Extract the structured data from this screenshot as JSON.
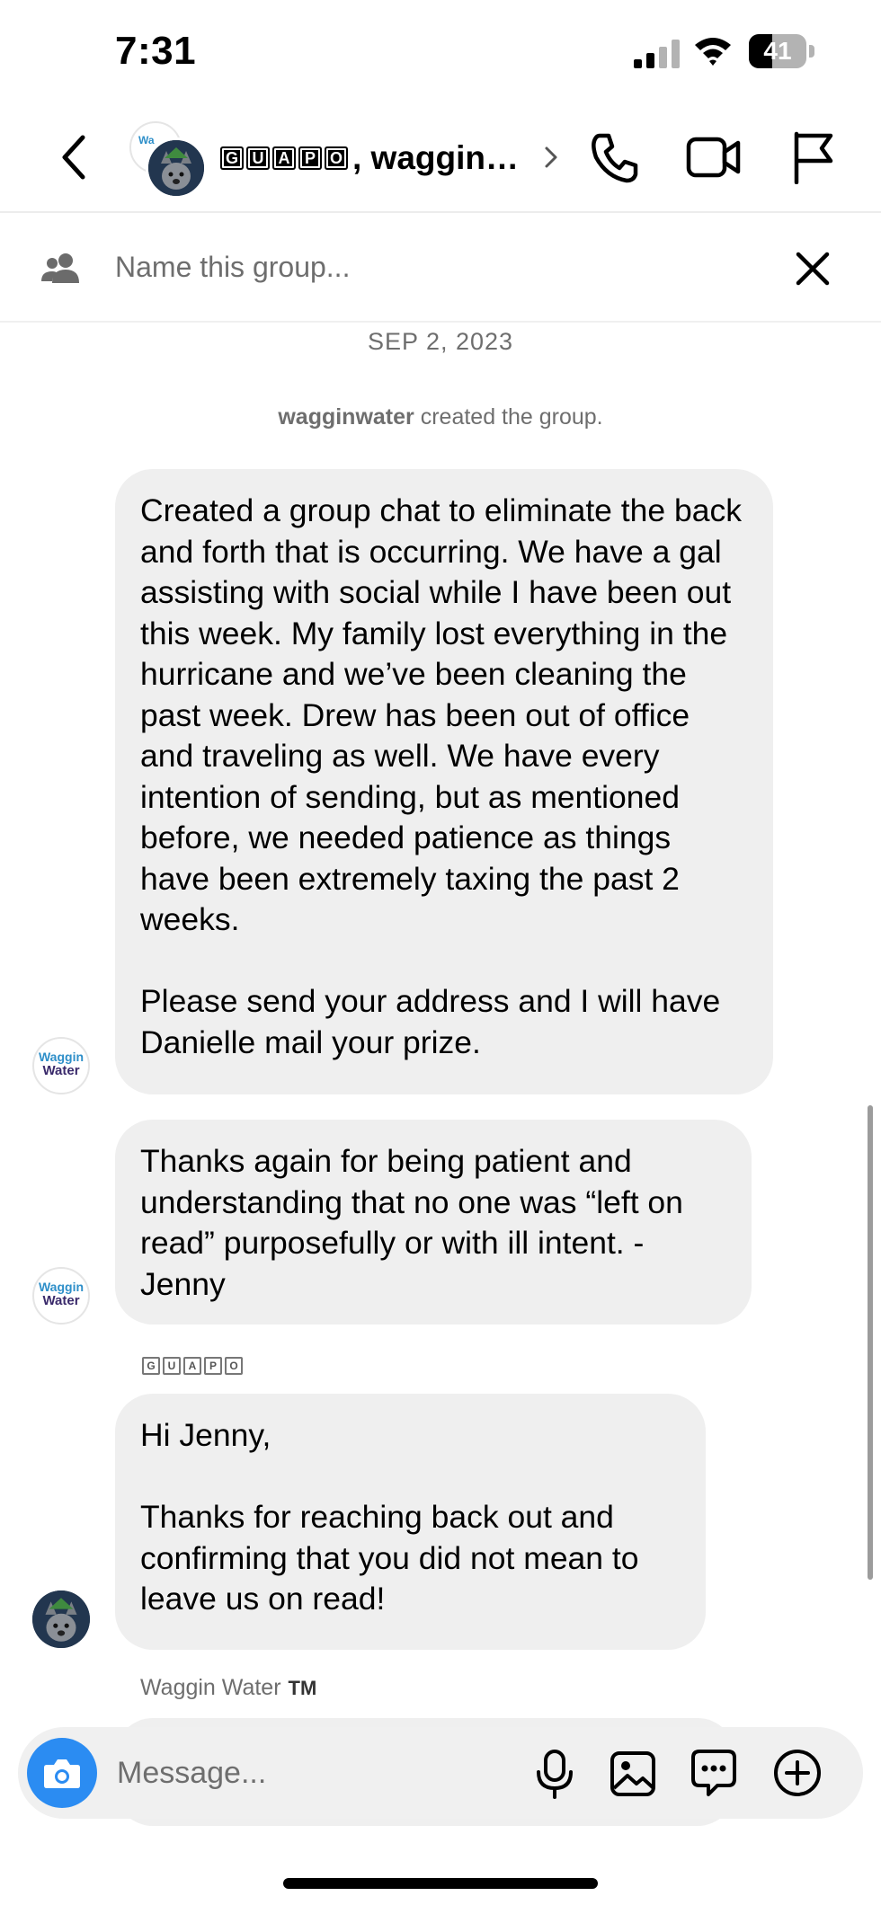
{
  "status_bar": {
    "time": "7:31",
    "battery": "41",
    "battery_level": 0.41
  },
  "header": {
    "group_name_boxed": [
      "G",
      "U",
      "A",
      "P",
      "O"
    ],
    "group_name_rest": ", waggin…",
    "avatar_back_text": "Wa"
  },
  "group_name_field": {
    "placeholder": "Name this group..."
  },
  "thread": {
    "date": "SEP 2, 2023",
    "system_user": "wagginwater",
    "system_text": " created the group.",
    "avatar_ww_line1": "Waggin",
    "avatar_ww_line2": "Water",
    "messages": [
      {
        "text": "Created a group chat to eliminate the back and forth that is occurring.  We have a gal assisting with social while I have been out this week. My family lost everything in the hurricane and we’ve been cleaning the past week.  Drew has been out of office and traveling as well.  We have every intention of sending, but as mentioned before, we needed patience as things have been extremely taxing the past 2 weeks.\n\nPlease send your address and I will have Danielle mail your prize."
      },
      {
        "text": "Thanks again for being patient and understanding that no one was “left on read” purposefully or with ill intent. -Jenny"
      },
      {
        "sender_boxed": [
          "G",
          "U",
          "A",
          "P",
          "O"
        ],
        "text": "Hi Jenny,\n\nThanks for reaching back out and confirming that you did not mean to leave us on read!"
      },
      {
        "sender": "Waggin Water",
        "sender_mark": "TM",
        "text": ""
      }
    ]
  },
  "composer": {
    "placeholder": "Message..."
  },
  "colors": {
    "bubble": "#efefef",
    "camera_button": "#2b8cf2",
    "secondary_text": "#6e6e6e"
  },
  "icons": [
    "back-chevron-icon",
    "phone-icon",
    "video-camera-icon",
    "flag-icon",
    "people-icon",
    "close-icon",
    "camera-icon",
    "microphone-icon",
    "gallery-icon",
    "sticker-icon",
    "plus-circle-icon"
  ]
}
